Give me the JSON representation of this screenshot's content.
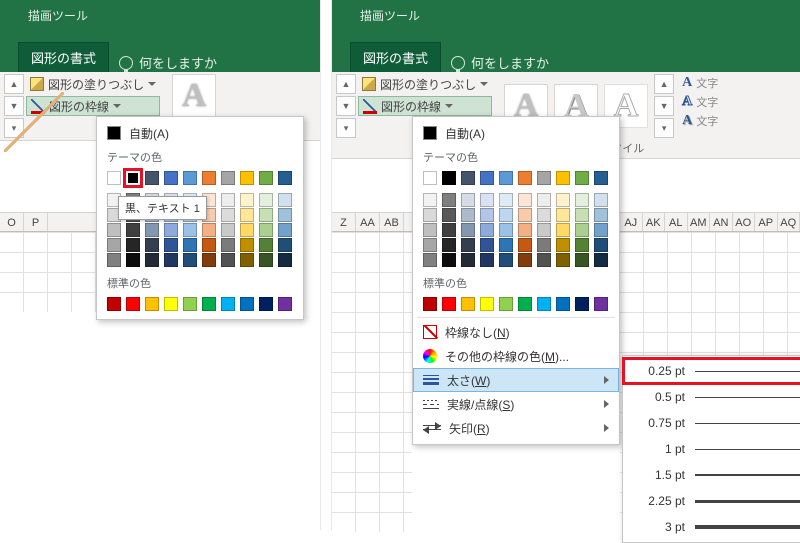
{
  "titlebar": {
    "context_tab": "描画ツール",
    "active_tab": "図形の書式",
    "tell_me": "何をしますか"
  },
  "ribbon": {
    "shape_fill": "図形の塗りつぶし",
    "shape_outline": "図形の枠線",
    "wordart_group": "ワードアートのスタイル",
    "text_fill": "文字",
    "text_outline": "文字",
    "text_effects": "文字"
  },
  "color_menu": {
    "auto": "自動(A)",
    "theme_heading": "テーマの色",
    "standard_heading": "標準の色",
    "no_outline": "枠線なし(N)",
    "more_colors": "その他の枠線の色(M)...",
    "weight": "太さ(W)",
    "dashes": "実線/点線(S)",
    "arrows": "矢印(R)",
    "tooltip_selected": "黒、テキスト 1",
    "theme_row1": [
      "#ffffff",
      "#000000",
      "#44546a",
      "#4472c4",
      "#5b9bd5",
      "#ed7d31",
      "#a5a5a5",
      "#ffc000",
      "#70ad47",
      "#255e91"
    ],
    "theme_shades": [
      [
        "#f2f2f2",
        "#7f7f7f",
        "#d6dce5",
        "#d9e1f2",
        "#ddebf7",
        "#fce4d6",
        "#ededed",
        "#fff2cc",
        "#e2efda",
        "#d0e0ed"
      ],
      [
        "#d9d9d9",
        "#595959",
        "#acb9ca",
        "#b4c6e7",
        "#bdd7ee",
        "#f8cbad",
        "#dbdbdb",
        "#ffe699",
        "#c6e0b4",
        "#a1c1db"
      ],
      [
        "#bfbfbf",
        "#404040",
        "#8497b0",
        "#8ea9db",
        "#9bc2e6",
        "#f4b084",
        "#c9c9c9",
        "#ffd966",
        "#a9d08e",
        "#72a2c9"
      ],
      [
        "#a6a6a6",
        "#262626",
        "#333f4f",
        "#305496",
        "#2f75b5",
        "#c65911",
        "#7b7b7b",
        "#bf8f00",
        "#548235",
        "#1f4e78"
      ],
      [
        "#808080",
        "#0d0d0d",
        "#222b35",
        "#203764",
        "#1f4e78",
        "#833c0c",
        "#525252",
        "#806000",
        "#375623",
        "#132c44"
      ]
    ],
    "standard": [
      "#c00000",
      "#ff0000",
      "#ffc000",
      "#ffff00",
      "#92d050",
      "#00b050",
      "#00b0f0",
      "#0070c0",
      "#002060",
      "#7030a0"
    ]
  },
  "weight_menu": {
    "items": [
      {
        "label": "0.25 pt",
        "px": 0.5
      },
      {
        "label": "0.5 pt",
        "px": 1
      },
      {
        "label": "0.75 pt",
        "px": 1
      },
      {
        "label": "1 pt",
        "px": 1.5
      },
      {
        "label": "1.5 pt",
        "px": 2
      },
      {
        "label": "2.25 pt",
        "px": 3
      },
      {
        "label": "3 pt",
        "px": 4
      }
    ],
    "selected_index": 0
  },
  "columns_left": [
    "O",
    "P"
  ],
  "columns_right_a": [
    "Z",
    "AA",
    "AB"
  ],
  "columns_right_b": [
    "AJ",
    "AK",
    "AL",
    "AM",
    "AN",
    "AO",
    "AP",
    "AQ"
  ]
}
